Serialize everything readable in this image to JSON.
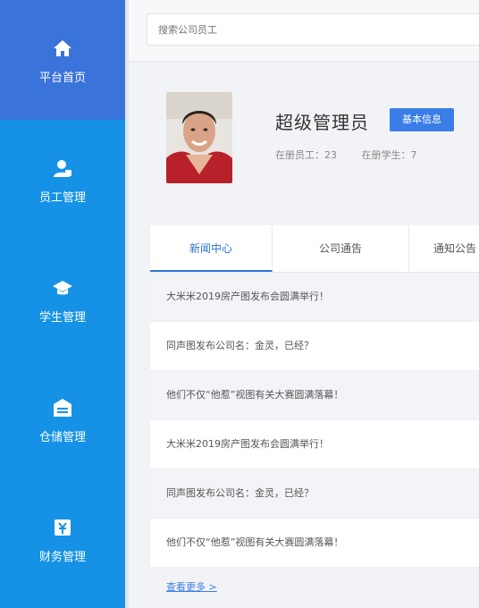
{
  "sidebar": {
    "items": [
      {
        "label": "平台首页",
        "icon": "home-icon",
        "active": true
      },
      {
        "label": "员工管理",
        "icon": "user-icon",
        "active": false
      },
      {
        "label": "学生管理",
        "icon": "graduation-cap-icon",
        "active": false
      },
      {
        "label": "仓储管理",
        "icon": "warehouse-icon",
        "active": false
      },
      {
        "label": "财务管理",
        "icon": "finance-icon",
        "active": false
      }
    ]
  },
  "search": {
    "placeholder": "搜索公司员工"
  },
  "profile": {
    "name": "超级管理员",
    "edit_label": "基本信息",
    "employees_label": "在册员工：23",
    "students_label": "在册学生：7"
  },
  "tabs": [
    {
      "label": "新闻中心",
      "active": true
    },
    {
      "label": "公司通告",
      "active": false
    },
    {
      "label": "通知公告",
      "active": false
    }
  ],
  "news": [
    "大米米2019房产图发布会圆满举行！",
    "同声图发布公司名：金灵，已经？",
    "他们不仅“他惹”视图有关大赛圆满落幕！",
    "大米米2019房产图发布会圆满举行！",
    "同声图发布公司名：金灵，已经？",
    "他们不仅“他惹”视图有关大赛圆满落幕！"
  ],
  "more_label": "查看更多 >",
  "colors": {
    "sidebar": "#1592e6",
    "active": "#3a73d9",
    "accent": "#3a7de6"
  }
}
